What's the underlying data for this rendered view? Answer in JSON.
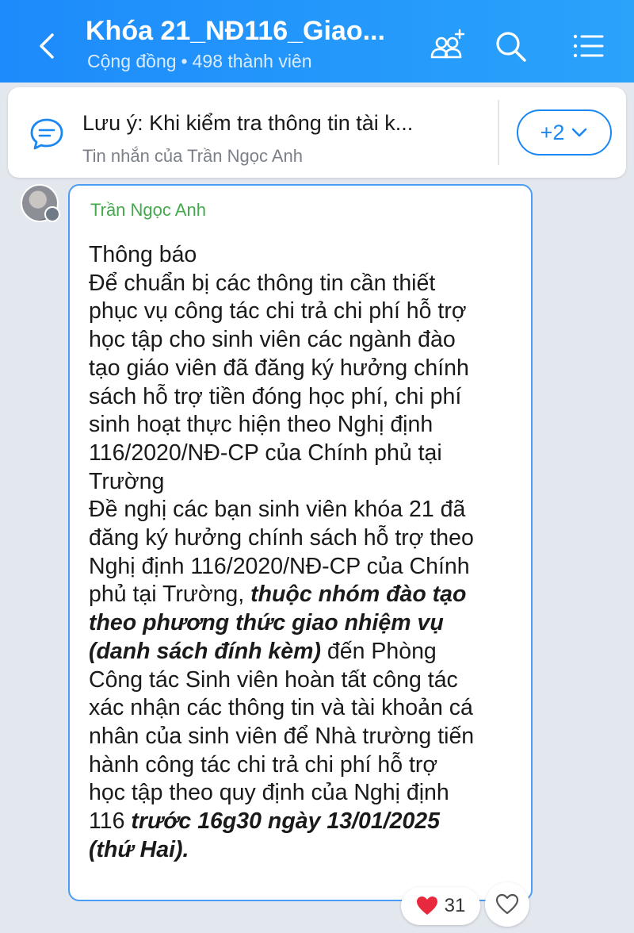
{
  "header": {
    "title": "Khóa 21_NĐ116_Giao...",
    "community_label": "Cộng đồng",
    "separator": "•",
    "member_count": "498 thành viên",
    "icons": [
      "back-icon",
      "add-member-icon",
      "search-icon",
      "menu-list-icon"
    ]
  },
  "pinned": {
    "title": "Lưu ý: Khi kiểm tra thông tin tài k...",
    "subtitle": "Tin nhắn của Trần Ngọc Anh",
    "more_label": "+2",
    "icon": "pinned-message-icon"
  },
  "message": {
    "sender": "Trần Ngọc Anh",
    "lines": [
      "Thông báo",
      "Để chuẩn bị các thông tin cần thiết",
      "phục vụ công tác chi trả chi phí hỗ trợ",
      "học tập cho sinh viên các ngành đào",
      "tạo giáo viên đã đăng ký hưởng chính",
      "sách hỗ trợ tiền đóng học phí, chi phí",
      "sinh hoạt thực hiện theo Nghị định",
      "116/2020/NĐ-CP của Chính phủ tại",
      "Trường",
      "Đề nghị các bạn sinh viên khóa 21 đã",
      "đăng ký hưởng chính sách hỗ trợ theo",
      "Nghị định 116/2020/NĐ-CP của Chính",
      "phủ tại Trường, ",
      "thuộc nhóm đào tạo",
      "theo phương thức giao nhiệm vụ",
      "(danh sách đính kèm)",
      " đến Phòng",
      "Công tác Sinh viên hoàn tất công tác",
      "xác nhận các thông tin và tài khoản cá",
      "nhân của sinh viên để Nhà trường tiến",
      "hành công tác chi trả chi phí hỗ trợ",
      "học tập theo quy định của Nghị định",
      "116 ",
      "trước 16g30 ngày 13/01/2025",
      "(thứ Hai)."
    ]
  },
  "reactions": {
    "emoji": "❤️",
    "count": "31",
    "like_icon": "heart-outline-icon"
  },
  "colors": {
    "header_start": "#1d8bfb",
    "header_end": "#2aa3fb",
    "bubble_border": "#4b9cf4",
    "sender_name": "#43a94c",
    "accent": "#1b87f3"
  }
}
